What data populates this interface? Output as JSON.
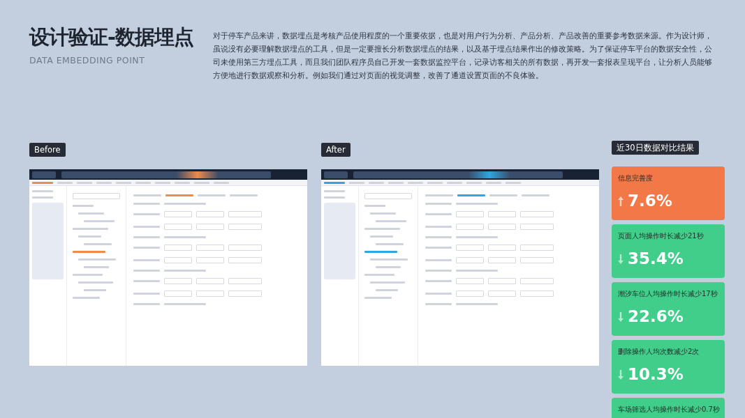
{
  "header": {
    "title": "设计验证-数据埋点",
    "subtitle": "DATA EMBEDDING POINT",
    "description": "对于停车产品来讲，数据埋点是考核产品使用程度的一个重要依据，也是对用户行为分析、产品分析、产品改善的重要参考数据来源。作为设计师，虽说没有必要理解数据埋点的工具，但是一定要擅长分析数据埋点的结果，以及基于埋点结果作出的修改策略。为了保证停车平台的数据安全性，公司未使用第三方埋点工具，而且我们团队程序员自己开发一套数据监控平台，记录访客相关的所有数据，再开发一套报表呈现平台，让分析人员能够方便地进行数据观察和分析。例如我们通过对页面的视觉调整，改善了通道设置页面的不良体验。"
  },
  "panels": [
    {
      "label": "Before",
      "kind": "before"
    },
    {
      "label": "After",
      "kind": "after"
    }
  ],
  "results": {
    "label": "近30日数据对比结果",
    "cards": [
      {
        "title": "信息完善度",
        "kind": "up",
        "value": "7.6%"
      },
      {
        "title": "页面人均操作时长减少21秒",
        "kind": "down",
        "value": "35.4%"
      },
      {
        "title": "潮汐车位人均操作时长减少17秒",
        "kind": "down",
        "value": "22.6%"
      },
      {
        "title": "删除操作人均次数减少2次",
        "kind": "down",
        "value": "10.3%"
      },
      {
        "title": "车场筛选人均操作时长减少0.7秒",
        "kind": "down"
      }
    ]
  }
}
